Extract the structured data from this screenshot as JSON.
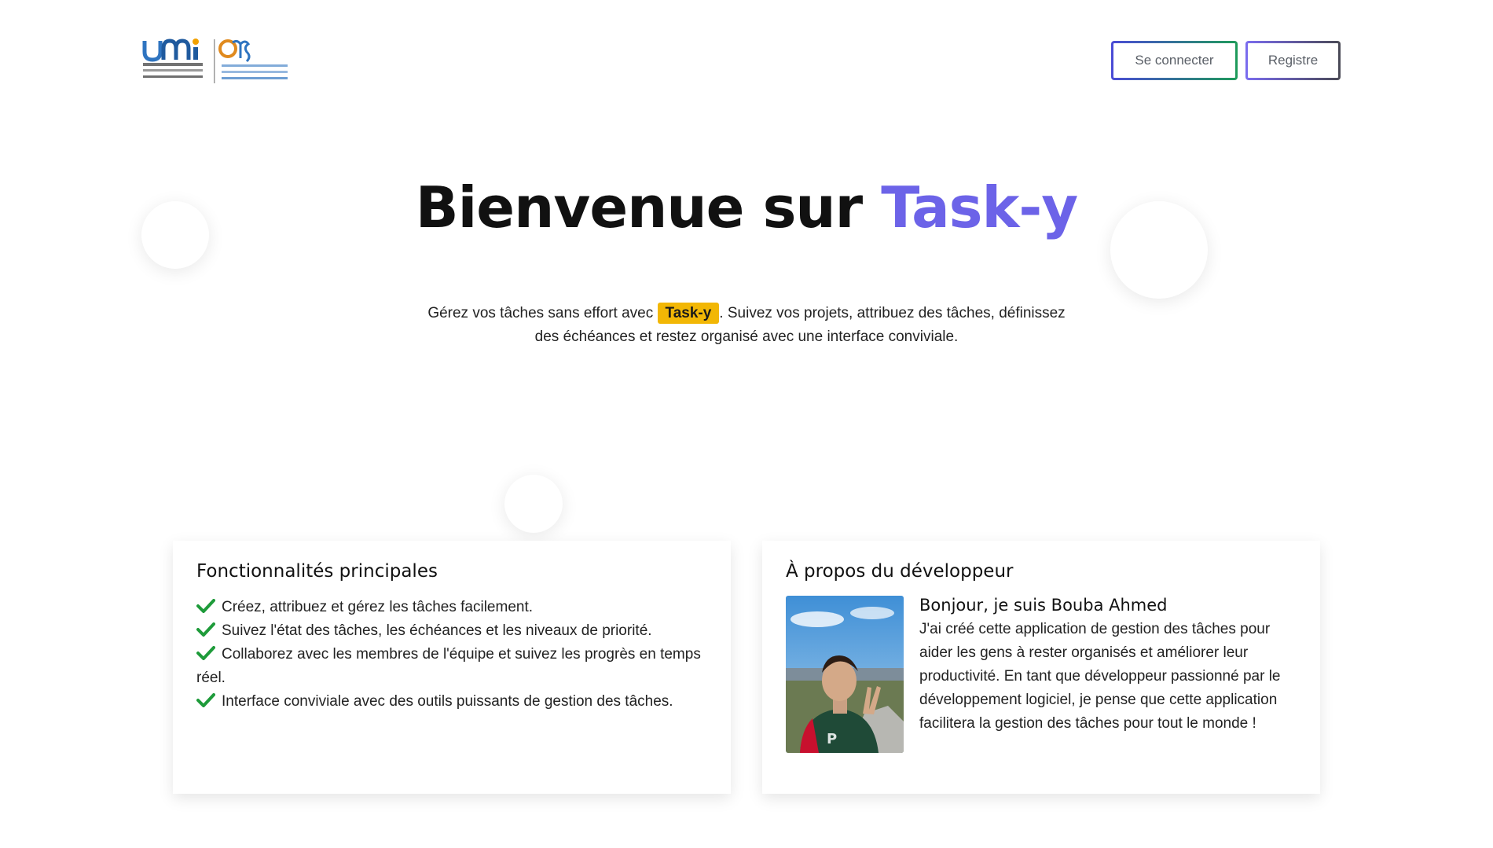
{
  "header": {
    "logo_alt": "UMI | ENS logo",
    "login_label": "Se connecter",
    "register_label": "Registre"
  },
  "hero": {
    "title_main": "Bienvenue sur",
    "title_accent": "Task-y",
    "text_before": "Gérez vos tâches sans effort avec",
    "highlight": "Task-y",
    "text_after": ". Suivez vos projets, attribuez des tâches, définissez des échéances et restez organisé avec une interface conviviale."
  },
  "features": {
    "title": "Fonctionnalités principales",
    "items": [
      "Créez, attribuez et gérez les tâches facilement.",
      "Suivez l'état des tâches, les échéances et les niveaux de priorité.",
      "Collaborez avec les membres de l'équipe et suivez les progrès en temps réel.",
      "Interface conviviale avec des outils puissants de gestion des tâches."
    ]
  },
  "developer": {
    "title": "À propos du développeur",
    "name": "Bonjour, je suis Bouba Ahmed",
    "bio": "J'ai créé cette application de gestion des tâches pour aider les gens à rester organisés et améliorer leur productivité. En tant que développeur passionné par le développement logiciel, je pense que cette application facilitera la gestion des tâches pour tout le monde !"
  },
  "colors": {
    "accent": "#6c63e8",
    "highlight": "#f2b705",
    "check": "#1e9b3a"
  },
  "icons": {
    "feature_bullet": "check-icon"
  }
}
